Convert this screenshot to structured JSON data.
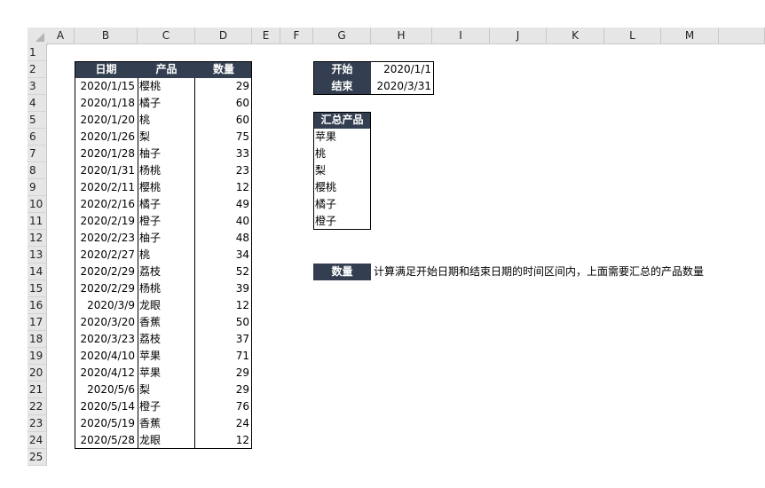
{
  "columns": [
    "A",
    "B",
    "C",
    "D",
    "E",
    "F",
    "G",
    "H",
    "I",
    "J",
    "K",
    "L",
    "M"
  ],
  "rows": [
    "1",
    "2",
    "3",
    "4",
    "5",
    "6",
    "7",
    "8",
    "9",
    "10",
    "11",
    "12",
    "13",
    "14",
    "15",
    "16",
    "17",
    "18",
    "19",
    "20",
    "21",
    "22",
    "23",
    "24",
    "25"
  ],
  "table": {
    "headers": [
      "日期",
      "产品",
      "数量"
    ],
    "rows": [
      [
        "2020/1/15",
        "樱桃",
        "29"
      ],
      [
        "2020/1/18",
        "橘子",
        "60"
      ],
      [
        "2020/1/20",
        "桃",
        "60"
      ],
      [
        "2020/1/26",
        "梨",
        "75"
      ],
      [
        "2020/1/28",
        "柚子",
        "33"
      ],
      [
        "2020/1/31",
        "杨桃",
        "23"
      ],
      [
        "2020/2/11",
        "樱桃",
        "12"
      ],
      [
        "2020/2/16",
        "橘子",
        "49"
      ],
      [
        "2020/2/19",
        "橙子",
        "40"
      ],
      [
        "2020/2/23",
        "柚子",
        "48"
      ],
      [
        "2020/2/27",
        "桃",
        "34"
      ],
      [
        "2020/2/29",
        "荔枝",
        "52"
      ],
      [
        "2020/2/29",
        "杨桃",
        "39"
      ],
      [
        "2020/3/9",
        "龙眼",
        "12"
      ],
      [
        "2020/3/20",
        "香蕉",
        "50"
      ],
      [
        "2020/3/23",
        "荔枝",
        "37"
      ],
      [
        "2020/4/10",
        "苹果",
        "71"
      ],
      [
        "2020/4/12",
        "苹果",
        "29"
      ],
      [
        "2020/5/6",
        "梨",
        "29"
      ],
      [
        "2020/5/14",
        "橙子",
        "76"
      ],
      [
        "2020/5/19",
        "香蕉",
        "24"
      ],
      [
        "2020/5/28",
        "龙眼",
        "12"
      ]
    ]
  },
  "date_range": {
    "start_label": "开始",
    "start_value": "2020/1/1",
    "end_label": "结束",
    "end_value": "2020/3/31"
  },
  "summary": {
    "header": "汇总产品",
    "items": [
      "苹果",
      "桃",
      "梨",
      "樱桃",
      "橘子",
      "橙子"
    ]
  },
  "quantity": {
    "label": "数量",
    "note": "计算满足开始日期和结束日期的时间区间内，上面需要汇总的产品数量"
  },
  "colors": {
    "header_bg": "#333f50",
    "grid_header_bg": "#e6e6e6"
  }
}
